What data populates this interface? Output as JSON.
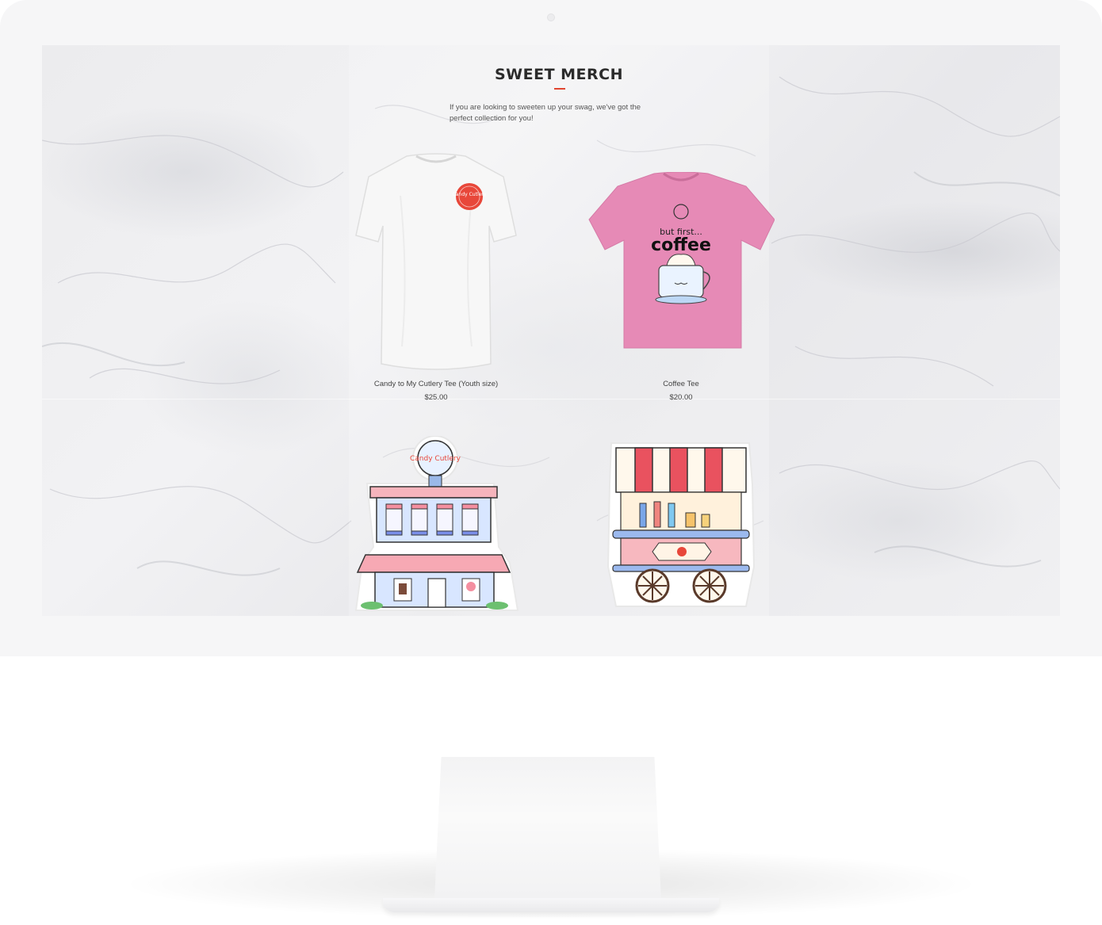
{
  "section": {
    "title": "SWEET MERCH",
    "intro": "If you are looking to sweeten up your swag, we've got the perfect collection for you!"
  },
  "products": [
    {
      "name": "Candy to My Cutlery Tee (Youth size)",
      "price": "$25.00",
      "image": "white-tshirt-with-candy-cutlery-logo",
      "logo_text": "Candy Cutlery"
    },
    {
      "name": "Coffee Tee",
      "price": "$20.00",
      "image": "pink-tshirt-but-first-coffee",
      "print_line1": "but first...",
      "print_line2": "coffee"
    },
    {
      "image": "candy-shop-building-sticker",
      "sign_text": "Candy Cutlery"
    },
    {
      "image": "candy-cart-sticker"
    }
  ],
  "colors": {
    "accent": "#e0452f",
    "title": "#2b2b2b",
    "pink_tee": "#e68ab6",
    "logo_red": "#e8473a"
  }
}
